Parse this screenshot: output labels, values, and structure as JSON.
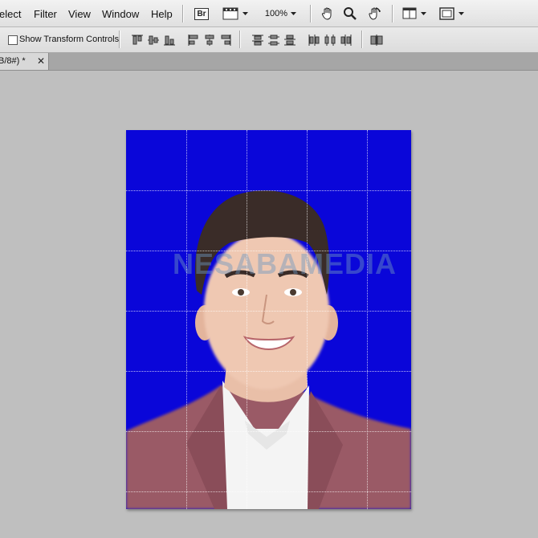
{
  "menu": {
    "items": [
      "elect",
      "Filter",
      "View",
      "Window",
      "Help"
    ],
    "bridge_badge": "Br",
    "zoom": "100%"
  },
  "options": {
    "show_transform_label": "Show Transform Controls",
    "show_transform_checked": false
  },
  "document": {
    "tab_label": "B/8#) *",
    "close_glyph": "✕"
  },
  "canvas": {
    "watermark": "NESABAMEDIA",
    "background_color": "#0a06d9"
  },
  "icons": [
    "hand-icon",
    "zoom-icon",
    "rotate-view-icon",
    "arrange-documents-icon",
    "screen-mode-icon"
  ],
  "colors": {
    "menubar": "#e8e8e8",
    "workspace": "#bfbfbf",
    "canvas_blue": "#0a06d9",
    "jacket": "#9a5a66"
  }
}
